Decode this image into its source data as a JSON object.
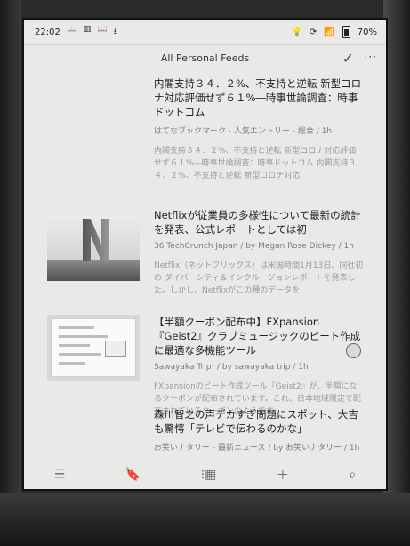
{
  "status": {
    "time": "22:02",
    "battery": "70%",
    "battery_level": 0.7
  },
  "header": {
    "title": "All Personal Feeds"
  },
  "articles": [
    {
      "title": "内閣支持３４．２%、不支持と逆転 新型コロナ対応評価せず６１%―時事世論調査：時事ドットコム",
      "meta": "はてなブックマーク - 人気エントリー - 総合 / 1h",
      "snippet": "内閣支持３４．２%、不支持と逆転 新型コロナ対応評価せず６１%―時事世論調査：時事ドットコム 内閣支持３４．２%、不支持と逆転 新型コロナ対応"
    },
    {
      "title": "Netflixが従業員の多様性について最新の統計を発表、公式レポートとしては初",
      "meta": "36 TechCrunch Japan / by Megan Rose Dickey / 1h",
      "snippet": "Netflix（ネットフリックス）は米国時間1月13日、同社初の ダイバーシティ＆インクルージョンレポートを発表した。しかし、Netflixがこの種のデータを"
    },
    {
      "title": "【半額クーポン配布中】FXpansion『Geist2』クラブミュージックのビート作成に最適な多機能ツール",
      "meta": "Sawayaka Trip! / by sawayaka trip / 1h",
      "snippet": "FXpansionのビート作成ツール『Geist2』が、半額になるクーポンが配布されています。これ、日本地域限定で配布されているクーポンのようです。"
    },
    {
      "title": "森川智之の声デカすぎ問題にスポット、大吉も驚愕「テレビで伝わるのかな」",
      "meta": "お笑いナタリー - 最新ニュース / by お笑いナタリー / 1h",
      "snippet": ""
    }
  ]
}
